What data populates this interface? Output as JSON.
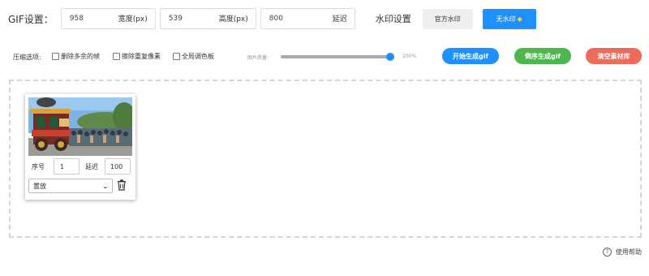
{
  "gif_settings": {
    "label": "GIF设置：",
    "width": {
      "value": "958",
      "suffix": "宽度(px)"
    },
    "height": {
      "value": "539",
      "suffix": "高度(px)"
    },
    "delay": {
      "value": "800",
      "suffix": "延迟"
    }
  },
  "watermark": {
    "label": "水印设置",
    "official_label": "官方水印",
    "none_label": "无水印",
    "none_icon": "diamond-icon"
  },
  "compression": {
    "label": "压缩选项:",
    "options": [
      "删除多余的帧",
      "擦除重复像素",
      "全局调色板"
    ],
    "quality_label": "图片质量:",
    "quality_value": "100%",
    "quality_fraction": 1.0
  },
  "actions": {
    "start_label": "开始生成gif",
    "reverse_label": "倒序生成gif",
    "clear_label": "清空素材库"
  },
  "frames": [
    {
      "seq_label": "序号",
      "seq_value": "1",
      "delay_label": "延迟",
      "delay_value": "100",
      "mode_selected": "置放"
    }
  ],
  "help": {
    "label": "使用帮助",
    "icon": "question-circle-icon"
  },
  "colors": {
    "primary": "#1e90ff",
    "green": "#4cb74c",
    "red": "#ee6a5a"
  }
}
